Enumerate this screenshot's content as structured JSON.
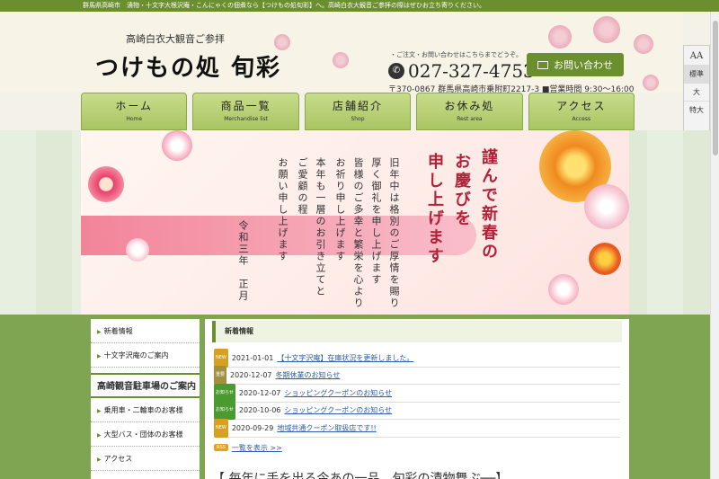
{
  "topbar": {
    "text": "群馬県高崎市　漬物・十文字大根沢庵・こんにゃくの佃煮なら【つけもの処旬彩】へ。高崎白衣大観音ご参拝の際はぜひお立ち寄りください。"
  },
  "header": {
    "subtitle": "高崎白衣大観音ご参拝",
    "logo": "つけもの処 旬彩",
    "contact_note": "・ご注文・お問い合わせはこちらまでどうぞ。",
    "phone": "027-327-4753",
    "contact_button": "お問い合わせ",
    "address": "〒370-0867 群馬県高崎市乗附町2217-3 ■営業時間 9:30～16:00"
  },
  "font_panel": {
    "icon": "AA",
    "options": [
      "標準",
      "大",
      "特大"
    ],
    "selected": "標準"
  },
  "nav": [
    {
      "jp": "ホーム",
      "en": "Home"
    },
    {
      "jp": "商品一覧",
      "en": "Merchandise list"
    },
    {
      "jp": "店舗紹介",
      "en": "Shop"
    },
    {
      "jp": "お休み処",
      "en": "Rest area"
    },
    {
      "jp": "アクセス",
      "en": "Access"
    }
  ],
  "hero": {
    "title_lines": [
      "謹んで新春の",
      "お慶びを",
      "申し上げます"
    ],
    "body_lines": [
      "旧年中は格別のご厚情を賜り",
      "厚く御礼を申し上げます",
      "皆様のご多幸と繁栄を心より",
      "お祈り申し上げます",
      "本年も一層のお引き立てと",
      "ご愛顧の程",
      "お願い申し上げます"
    ],
    "date_line": "令和三年　正月"
  },
  "sidebar": {
    "items": [
      "新着情報",
      "十文字沢庵のご案内"
    ],
    "section_title": "高崎観音駐車場のご案内",
    "section_items": [
      "乗用車・二輪車のお客様",
      "大型バス・団体のお客様",
      "アクセス"
    ]
  },
  "news": {
    "title": "新着情報",
    "rows": [
      {
        "tag": "NEW",
        "date": "2021-01-01",
        "text": "【十文字沢庵】在庫状況を更新しました。"
      },
      {
        "tag": "重要",
        "date": "2020-12-07",
        "text": "冬期休業のお知らせ"
      },
      {
        "tag": "お知らせ",
        "date": "2020-12-07",
        "text": "ショッピングクーポンのお知らせ"
      },
      {
        "tag": "お知らせ",
        "date": "2020-10-06",
        "text": "ショッピングクーポンのお知らせ"
      },
      {
        "tag": "NEW",
        "date": "2020-09-29",
        "text": "地域共通クーポン取扱店です!!"
      }
    ],
    "rss_label": "RSS",
    "more_link": "一覧を表示 >>"
  },
  "bottom_heading": "【 毎年に手を出る今あの一品、旬彩の漬物舞ぶ──】"
}
